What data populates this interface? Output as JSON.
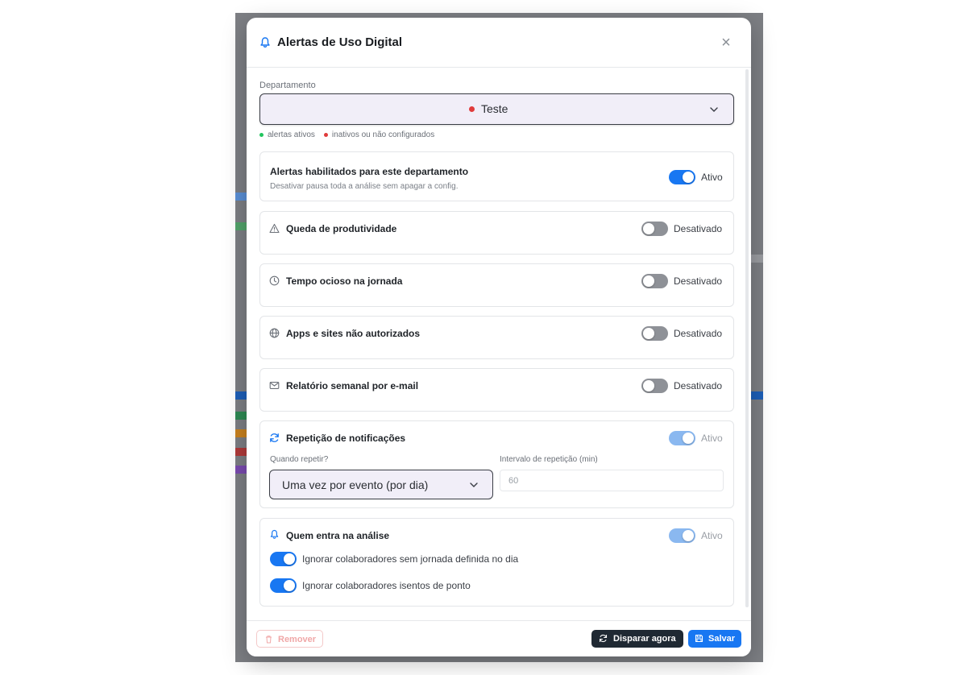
{
  "modal": {
    "title": "Alertas de Uso Digital",
    "close": "×"
  },
  "department": {
    "label": "Departamento",
    "selected": "Teste",
    "legend_active": "alertas ativos",
    "legend_inactive": "inativos ou não configurados"
  },
  "colors": {
    "accent": "#1877f2",
    "active_dot": "#22c55e",
    "inactive_dot": "#e03b3b",
    "toggle_off": "#8e9197",
    "dark_button": "#1f2933"
  },
  "enabled_card": {
    "title": "Alertas habilitados para este departamento",
    "subtitle": "Desativar pausa toda a análise sem apagar a config.",
    "status": "Ativo",
    "on": true
  },
  "alerts": [
    {
      "title": "Queda de produtividade",
      "icon": "warning-triangle-icon",
      "status": "Desativado",
      "on": false
    },
    {
      "title": "Tempo ocioso na jornada",
      "icon": "clock-icon",
      "status": "Desativado",
      "on": false
    },
    {
      "title": "Apps e sites não autorizados",
      "icon": "globe-icon",
      "status": "Desativado",
      "on": false
    },
    {
      "title": "Relatório semanal por e-mail",
      "icon": "mail-icon",
      "status": "Desativado",
      "on": false
    }
  ],
  "repeat": {
    "title": "Repetição de notificações",
    "status": "Ativo",
    "when_label": "Quando repetir?",
    "when_value": "Uma vez por evento (por dia)",
    "interval_label": "Intervalo de repetição (min)",
    "interval_value": "60"
  },
  "analysis": {
    "title": "Quem entra na análise",
    "status": "Ativo",
    "option1": "Ignorar colaboradores sem jornada definida no dia",
    "option2": "Ignorar colaboradores isentos de ponto"
  },
  "footer": {
    "remove": "Remover",
    "trigger": "Disparar agora",
    "save": "Salvar"
  }
}
